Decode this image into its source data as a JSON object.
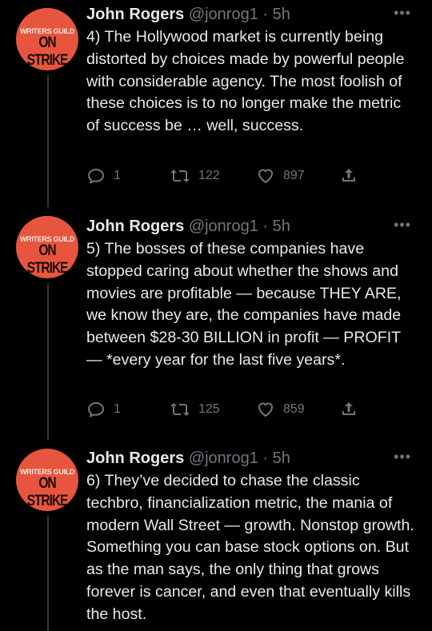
{
  "tweets": [
    {
      "name": "John Rogers",
      "handle": "@jonrog1",
      "separator": "·",
      "time": "5h",
      "avatar": {
        "line1": "WRITERS GUILD",
        "line2": "ON STRIKE"
      },
      "text": "4) The Hollywood market is currently being distorted by choices made by powerful people with considerable agency. The most foolish of these choices is to no longer make the metric of success be … well, success.",
      "replies": "1",
      "retweets": "122",
      "likes": "897"
    },
    {
      "name": "John Rogers",
      "handle": "@jonrog1",
      "separator": "·",
      "time": "5h",
      "avatar": {
        "line1": "WRITERS GUILD",
        "line2": "ON STRIKE"
      },
      "text": "5) The bosses of these companies have stopped caring about whether the shows and movies are profitable — because THEY ARE, we know they are, the companies have made between $28-30 BILLION in profit — PROFIT — *every year for the last five years*.",
      "replies": "1",
      "retweets": "125",
      "likes": "859"
    },
    {
      "name": "John Rogers",
      "handle": "@jonrog1",
      "separator": "·",
      "time": "5h",
      "avatar": {
        "line1": "WRITERS GUILD",
        "line2": "ON STRIKE"
      },
      "text": "6) They’ve decided to chase the classic techbro, financialization metric, the mania of modern Wall Street — growth. Nonstop growth. Something you can base stock options on. But as the man says, the only thing that grows forever is cancer, and even that eventually kills the host."
    }
  ],
  "more_icon": "more-horizontal-icon",
  "colors": {
    "background": "#000000",
    "text": "#e7e9ea",
    "muted": "#71767b",
    "avatar_bg": "#e8553e"
  }
}
